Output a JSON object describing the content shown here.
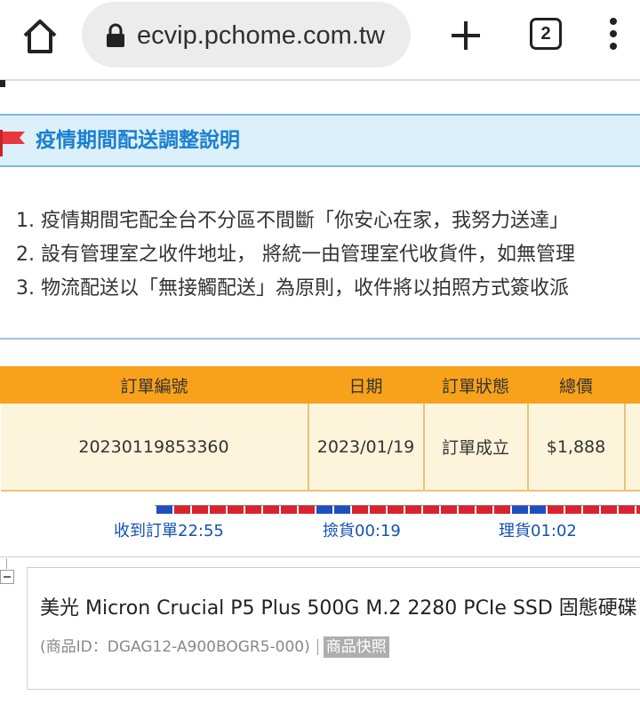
{
  "browser": {
    "url": "ecvip.pchome.com.tw",
    "tab_count": "2"
  },
  "notice": {
    "title": "疫情期間配送調整說明",
    "items": [
      "1. 疫情期間宅配全台不分區不間斷「你安心在家，我努力送達」",
      "2. 設有管理室之收件地址， 將統一由管理室代收貨件，如無管理",
      "3. 物流配送以「無接觸配送」為原則，收件將以拍照方式簽收派"
    ]
  },
  "order": {
    "headers": [
      "訂單編號",
      "日期",
      "訂單狀態",
      "總價"
    ],
    "row": {
      "order_no": "20230119853360",
      "date": "2023/01/19",
      "status": "訂單成立",
      "total": "$1,888"
    }
  },
  "timeline": {
    "received": "收到訂單22:55",
    "picked": "撿貨00:19",
    "processed": "理貨01:02",
    "segments": [
      "blue",
      "red",
      "red",
      "red",
      "red",
      "red",
      "red",
      "red",
      "red",
      "blue",
      "blue",
      "red",
      "red",
      "red",
      "red",
      "red",
      "red",
      "red",
      "red",
      "red",
      "blue",
      "blue",
      "red",
      "red",
      "red",
      "red",
      "red",
      "red",
      "red"
    ]
  },
  "product": {
    "name": "美光 Micron Crucial P5 Plus 500G M.2 2280 PCIe SSD 固態硬碟",
    "id_text": "(商品ID：DGAG12-A900BOGR5-000)",
    "snapshot_label": "商品快照"
  },
  "colors": {
    "accent_blue": "#1a7fd0",
    "header_orange": "#f8a11b",
    "progress_blue": "#1f4fbf",
    "progress_red": "#d9232e"
  }
}
